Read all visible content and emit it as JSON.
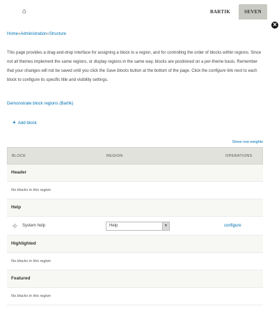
{
  "header": {
    "home_icon_glyph": "⌂",
    "theme_tabs": [
      {
        "label": "BARTIK",
        "active": false
      },
      {
        "label": "SEVEN",
        "active": true
      }
    ],
    "close_glyph": "✕"
  },
  "breadcrumb": [
    "Home",
    "Administration",
    "Structure"
  ],
  "help_text": {
    "p1": "This page provides a drag-and-drop interface for assigning a block to a region, and for controlling the order of blocks within regions. Since not all themes implement the same regions, or display regions in the same way, blocks are positioned on a per-theme basis. Remember that your changes will not be saved until you click the",
    "save_em": "Save blocks",
    "p2": "button at the bottom of the page. Click the",
    "configure_em": "configure",
    "p3": "link next to each block to configure its specific title and visibility settings."
  },
  "demo_link": "Demonstrate block regions (Bartik)",
  "add_block": "Add block",
  "show_weights": "Show row weights",
  "table": {
    "headers": [
      "BLOCK",
      "REGION",
      "OPERATIONS"
    ],
    "empty_text": "No blocks in this region",
    "sections": [
      {
        "region": "Header",
        "blocks": []
      },
      {
        "region": "Help",
        "blocks": [
          {
            "name": "System help",
            "region": "Help",
            "op": "configure"
          }
        ]
      },
      {
        "region": "Highlighted",
        "blocks": []
      },
      {
        "region": "Featured",
        "blocks": []
      }
    ]
  }
}
